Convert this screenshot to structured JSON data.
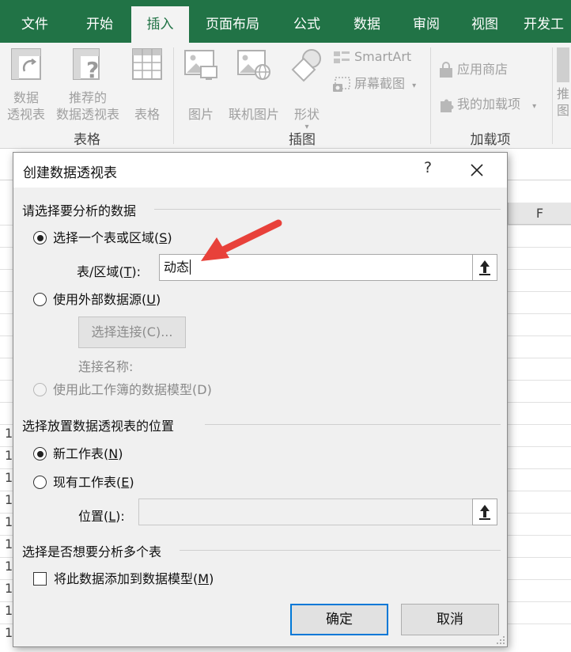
{
  "ribbon": {
    "tabs": [
      "文件",
      "开始",
      "插入",
      "页面布局",
      "公式",
      "数据",
      "审阅",
      "视图",
      "开发工"
    ],
    "active_tab": "插入",
    "groups": {
      "tables": {
        "label": "表格",
        "pivot_line1": "数据",
        "pivot_line2": "透视表",
        "recommended_line1": "推荐的",
        "recommended_line2": "数据透视表",
        "table": "表格"
      },
      "illustrations": {
        "label": "插图",
        "pictures": "图片",
        "online_pictures": "联机图片",
        "shapes": "形状",
        "smartart": "SmartArt",
        "screenshot": "屏幕截图"
      },
      "addins": {
        "label": "加载项",
        "store": "应用商店",
        "my_addins": "我的加载项"
      },
      "cut_off_line1": "推",
      "cut_off_line2": "图"
    }
  },
  "sheet": {
    "column_f": "F",
    "row_digits": [
      "1",
      "1",
      "1",
      "1",
      "1",
      "1",
      "1",
      "1",
      "1",
      "1"
    ]
  },
  "dialog": {
    "title": "创建数据透视表",
    "help": "?",
    "section1": "请选择要分析的数据",
    "opt_range_text": "选择一个表或区域(",
    "opt_range_key": "S",
    "opt_range_end": ")",
    "range_label_text": "表/区域(",
    "range_label_key": "T",
    "range_label_end": "):",
    "range_value": "动态",
    "opt_external_text": "使用外部数据源(",
    "opt_external_key": "U",
    "opt_external_end": ")",
    "choose_conn_text": "选择连接(",
    "choose_conn_key": "C",
    "choose_conn_end": ")...",
    "conn_name_label": "连接名称:",
    "opt_datamodel": "使用此工作簿的数据模型(D)",
    "section2": "选择放置数据透视表的位置",
    "opt_new_text": "新工作表(",
    "opt_new_key": "N",
    "opt_new_end": ")",
    "opt_existing_text": "现有工作表(",
    "opt_existing_key": "E",
    "opt_existing_end": ")",
    "location_label_text": "位置(",
    "location_label_key": "L",
    "location_label_end": "):",
    "location_value": "",
    "section3": "选择是否想要分析多个表",
    "add_model_text": "将此数据添加到数据模型(",
    "add_model_key": "M",
    "add_model_end": ")",
    "ok": "确定",
    "cancel": "取消"
  },
  "colors": {
    "excel_green": "#217346",
    "annotation_red": "#e8413a",
    "focus_blue": "#0078d7"
  }
}
